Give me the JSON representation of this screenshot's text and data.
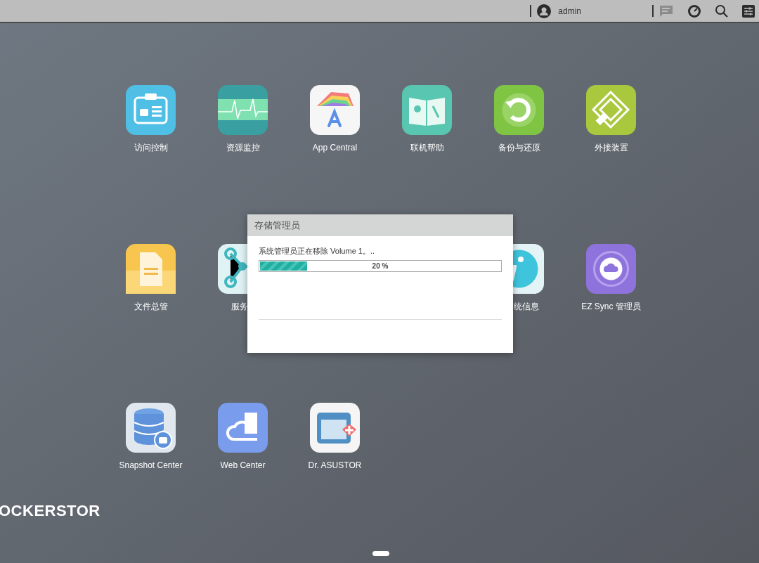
{
  "top_bar": {
    "user": "admin"
  },
  "apps": [
    {
      "items": [
        {
          "kind": "app",
          "label": "访问控制"
        },
        {
          "kind": "app",
          "label": "资源监控"
        },
        {
          "kind": "app",
          "label": "App Central"
        },
        {
          "kind": "app",
          "label": "联机帮助"
        },
        {
          "kind": "app",
          "label": "备份与还原"
        },
        {
          "kind": "app",
          "label": "外接装置"
        }
      ]
    },
    {
      "items": [
        {
          "kind": "app",
          "label": "文件总管"
        },
        {
          "kind": "app_cut_end",
          "label": "服务"
        },
        {
          "kind": "covered"
        },
        {
          "kind": "covered"
        },
        {
          "kind": "app_cut_start",
          "label": "统信息"
        },
        {
          "kind": "app",
          "label": "EZ Sync 管理员"
        }
      ]
    },
    {
      "items": [
        {
          "kind": "app",
          "label": "Snapshot Center"
        },
        {
          "kind": "app",
          "label": "Web Center"
        },
        {
          "kind": "app",
          "label": "Dr. ASUSTOR"
        }
      ]
    }
  ],
  "logo": "OCKERSTOR",
  "dialog": {
    "title": "存储管理员",
    "message": "系统管理员正在移除 Volume 1。..",
    "progress": {
      "level": 0.2,
      "reading": "20 %"
    }
  }
}
